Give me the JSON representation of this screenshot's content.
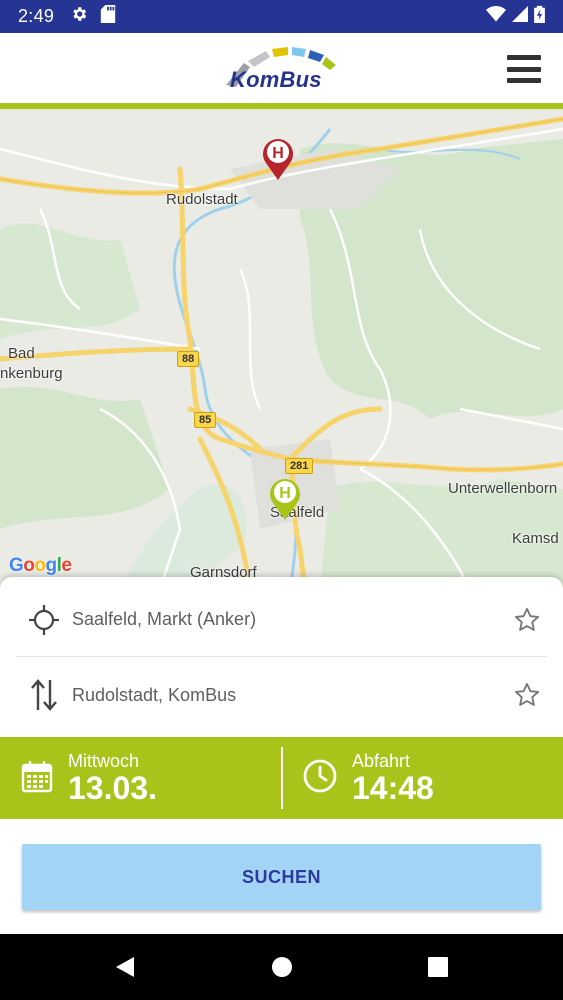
{
  "status_bar": {
    "time": "2:49",
    "icons": [
      "gear-icon",
      "sd-card-icon",
      "wifi-icon",
      "signal-icon",
      "battery-charging-icon"
    ]
  },
  "header": {
    "logo_text": "KomBus",
    "menu_icon": "hamburger-menu-icon",
    "accent_color": "#a8c41a",
    "brand_color": "#24338f"
  },
  "map": {
    "labels": {
      "rudolstadt": "Rudolstadt",
      "bad": "Bad",
      "blankenburg": "nkenburg",
      "saalfeld": "Saalfeld",
      "unterwellenborn": "Unterwellenborn",
      "kamsd": "Kamsd",
      "garnsdorf": "Garnsdorf"
    },
    "roads": {
      "r88": "88",
      "r85": "85",
      "r281": "281"
    },
    "google": "Google",
    "markers": [
      {
        "name": "destination-marker",
        "letter": "H",
        "color": "#b5252b"
      },
      {
        "name": "origin-marker",
        "letter": "H",
        "color": "#a8c41a"
      }
    ]
  },
  "stops": {
    "from": {
      "text": "Saalfeld, Markt (Anker)",
      "icon": "crosshair-location-icon"
    },
    "to": {
      "text": "Rudolstadt, KomBus",
      "icon": "swap-arrows-icon"
    },
    "favorite_icon": "star-outline-icon"
  },
  "datetime": {
    "date_label": "Mittwoch",
    "date_value": "13.03.",
    "time_label": "Abfahrt",
    "time_value": "14:48"
  },
  "search": {
    "button_label": "SUCHEN"
  },
  "nav_bar": {
    "icons": [
      "back-icon",
      "home-icon",
      "recents-icon"
    ]
  }
}
